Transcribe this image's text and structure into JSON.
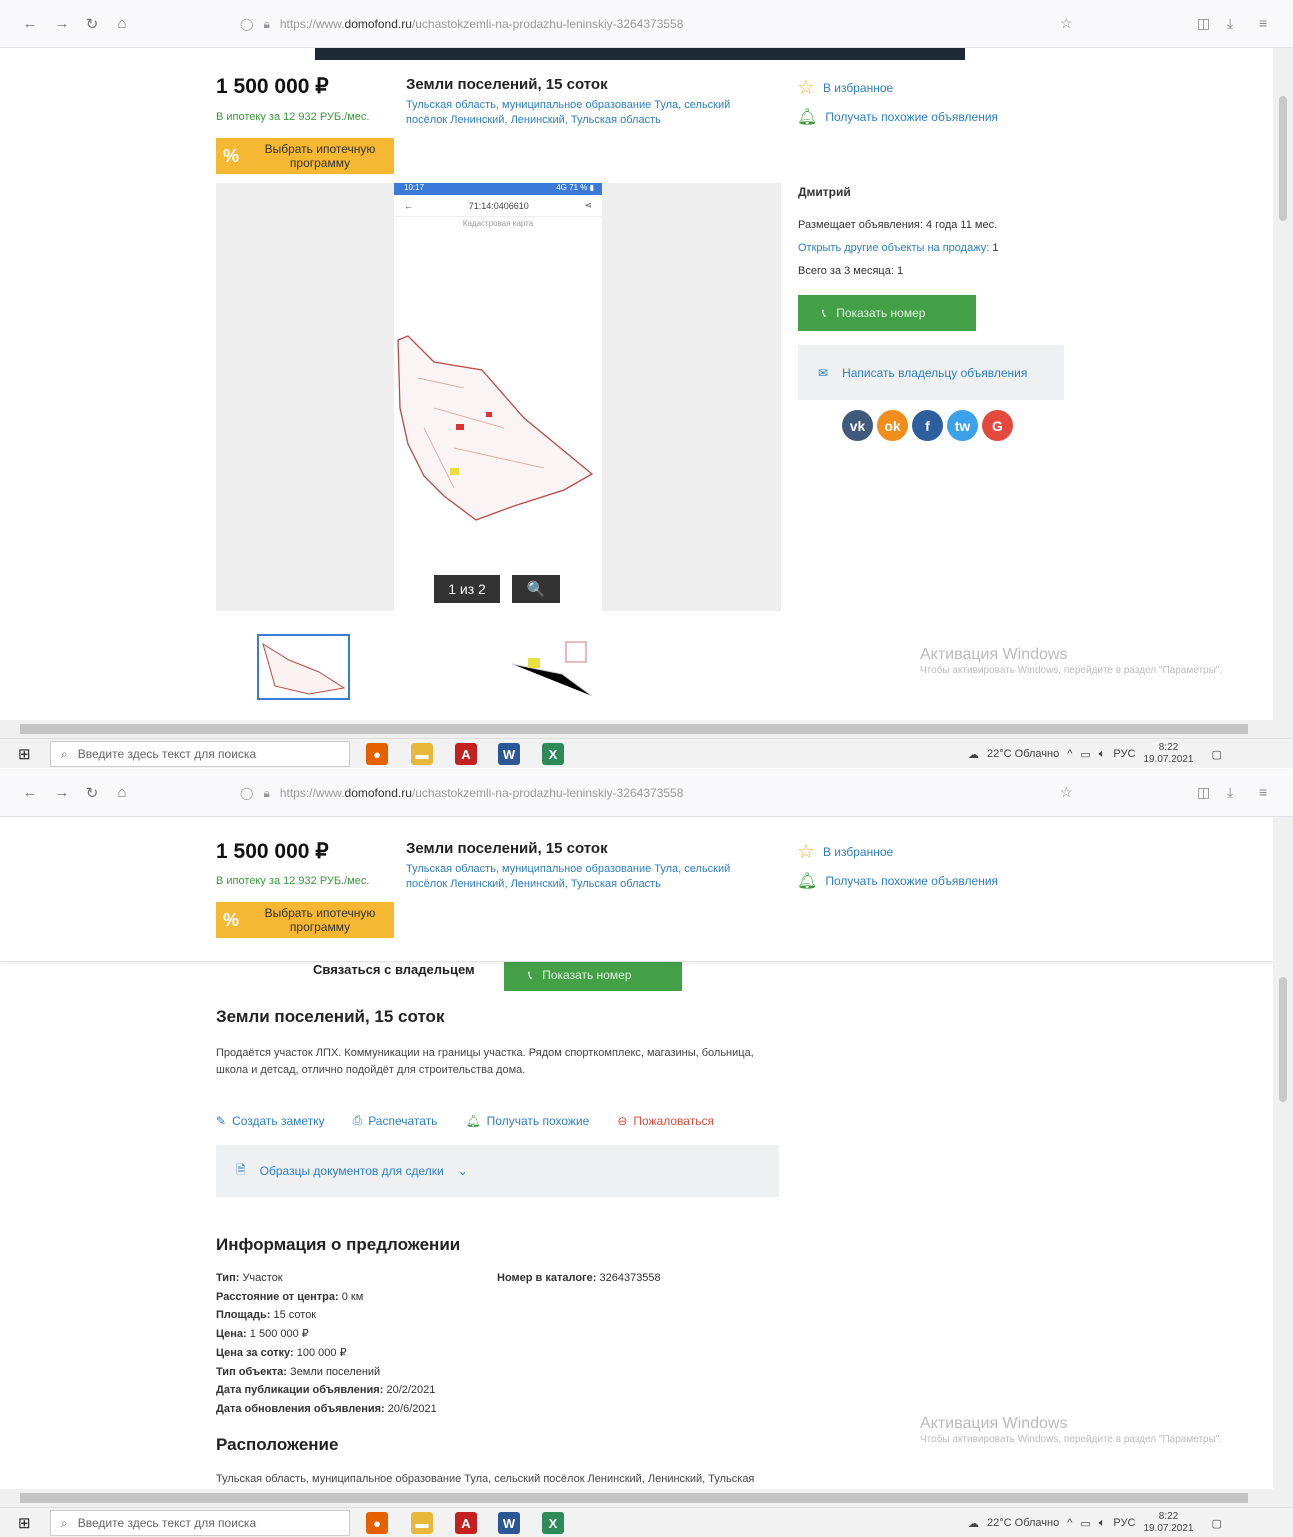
{
  "browser": {
    "url_prefix": "https://www.",
    "url_domain": "domofond.ru",
    "url_path": "/uchastokzemli-na-prodazhu-leninskiy-3264373558"
  },
  "listing": {
    "price": "1 500 000 ₽",
    "mortgage_text": "В ипотеку за 12 932 РУБ./мес.",
    "mortgage_button": "Выбрать ипотечную программу",
    "title": "Земли поселений, 15 соток",
    "address": "Тульская область, муниципальное образование Тула, сельский посёлок Ленинский, Ленинский, Тульская область",
    "favorite": "В избранное",
    "similar": "Получать похожие объявления"
  },
  "gallery": {
    "phone_time": "10:17",
    "phone_status": "4G 71 % ▮",
    "phone_number": "71:14:0406610",
    "phone_label": "Кадастровая карта",
    "counter": "1 из 2",
    "zoom_icon": "🔍"
  },
  "seller": {
    "name": "Дмитрий",
    "posting": "Размещает объявления: 4 года 11 мес.",
    "other_label": "Открыть другие объекты на продажу:",
    "other_count": "1",
    "total3m": "Всего за 3 месяца: 1",
    "show_number": "Показать номер",
    "write_owner": "Написать владельцу объявления"
  },
  "social": [
    "vk",
    "ok",
    "f",
    "tw",
    "G"
  ],
  "watermark": {
    "title": "Активация Windows",
    "text": "Чтобы активировать Windows, перейдите в раздел \"Параметры\"."
  },
  "taskbar": {
    "search_placeholder": "Введите здесь текст для поиска",
    "weather": "22°C  Облачно",
    "lang": "РУС",
    "time": "8:22",
    "date": "19.07.2021"
  },
  "details": {
    "contact_owner": "Связаться с владельцем",
    "heading": "Земли поселений, 15 соток",
    "description": "Продаётся участок ЛПХ. Коммуникации на границы участка. Рядом спорткомплекс, магазины, больница, школа и детсад, отлично подойдёт для строительства дома.",
    "actions": [
      "Создать заметку",
      "Распечатать",
      "Получать похожие",
      "Пожаловаться"
    ],
    "docs": "Образцы документов для сделки",
    "info_heading": "Информация о предложении",
    "info_rows": [
      {
        "label": "Тип:",
        "value": "Участок"
      },
      {
        "label": "Расстояние от центра:",
        "value": "0 км"
      },
      {
        "label": "Площадь:",
        "value": "15 соток"
      },
      {
        "label": "Цена:",
        "value": "1 500 000 ₽"
      },
      {
        "label": "Цена за сотку:",
        "value": "100 000 ₽"
      },
      {
        "label": "Тип объекта:",
        "value": "Земли поселений"
      },
      {
        "label": "Дата публикации объявления:",
        "value": "20/2/2021"
      },
      {
        "label": "Дата обновления объявления:",
        "value": "20/6/2021"
      }
    ],
    "catalog_label": "Номер в каталоге:",
    "catalog_value": "3264373558",
    "location_heading": "Расположение",
    "location_text": "Тульская область, муниципальное образование Тула, сельский посёлок Ленинский, Ленинский, Тульская область."
  }
}
